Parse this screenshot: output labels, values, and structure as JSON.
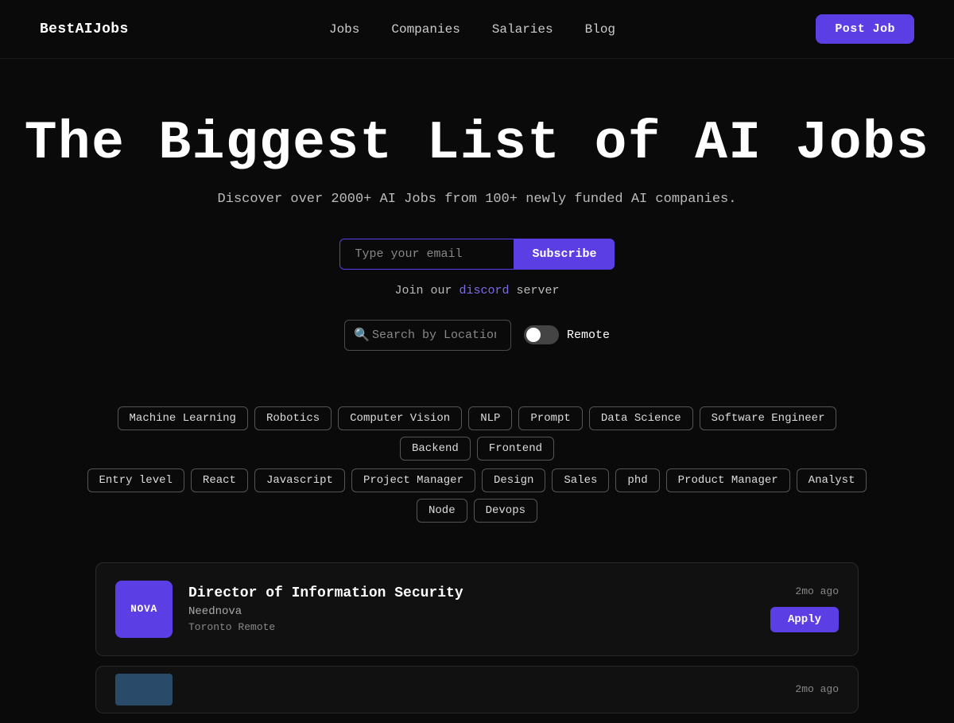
{
  "nav": {
    "logo": "BestAIJobs",
    "links": [
      {
        "label": "Jobs",
        "href": "#"
      },
      {
        "label": "Companies",
        "href": "#"
      },
      {
        "label": "Salaries",
        "href": "#"
      },
      {
        "label": "Blog",
        "href": "#"
      }
    ],
    "post_job_label": "Post Job"
  },
  "hero": {
    "title": "The Biggest List of AI Jobs",
    "subtitle": "Discover over 2000+ AI Jobs from 100+ newly funded AI companies.",
    "email_placeholder": "Type your email",
    "subscribe_label": "Subscribe",
    "discord_prefix": "Join our",
    "discord_link_label": "discord",
    "discord_suffix": "server"
  },
  "location": {
    "placeholder": "Search by Location",
    "remote_label": "Remote"
  },
  "tags": {
    "row1": [
      "Machine Learning",
      "Robotics",
      "Computer Vision",
      "NLP",
      "Prompt",
      "Data Science",
      "Software Engineer",
      "Backend",
      "Frontend"
    ],
    "row2": [
      "Entry level",
      "React",
      "Javascript",
      "Project Manager",
      "Design",
      "Sales",
      "phd",
      "Product Manager",
      "Analyst",
      "Node",
      "Devops"
    ]
  },
  "jobs": [
    {
      "id": 1,
      "title": "Director of Information Security",
      "company": "Neednova",
      "location": "Toronto",
      "work_type": "Remote",
      "time_ago": "2mo ago",
      "logo_text": "NOVA",
      "logo_color": "#5b3fe4"
    }
  ],
  "partial_job": {
    "time_ago": "2mo ago"
  }
}
